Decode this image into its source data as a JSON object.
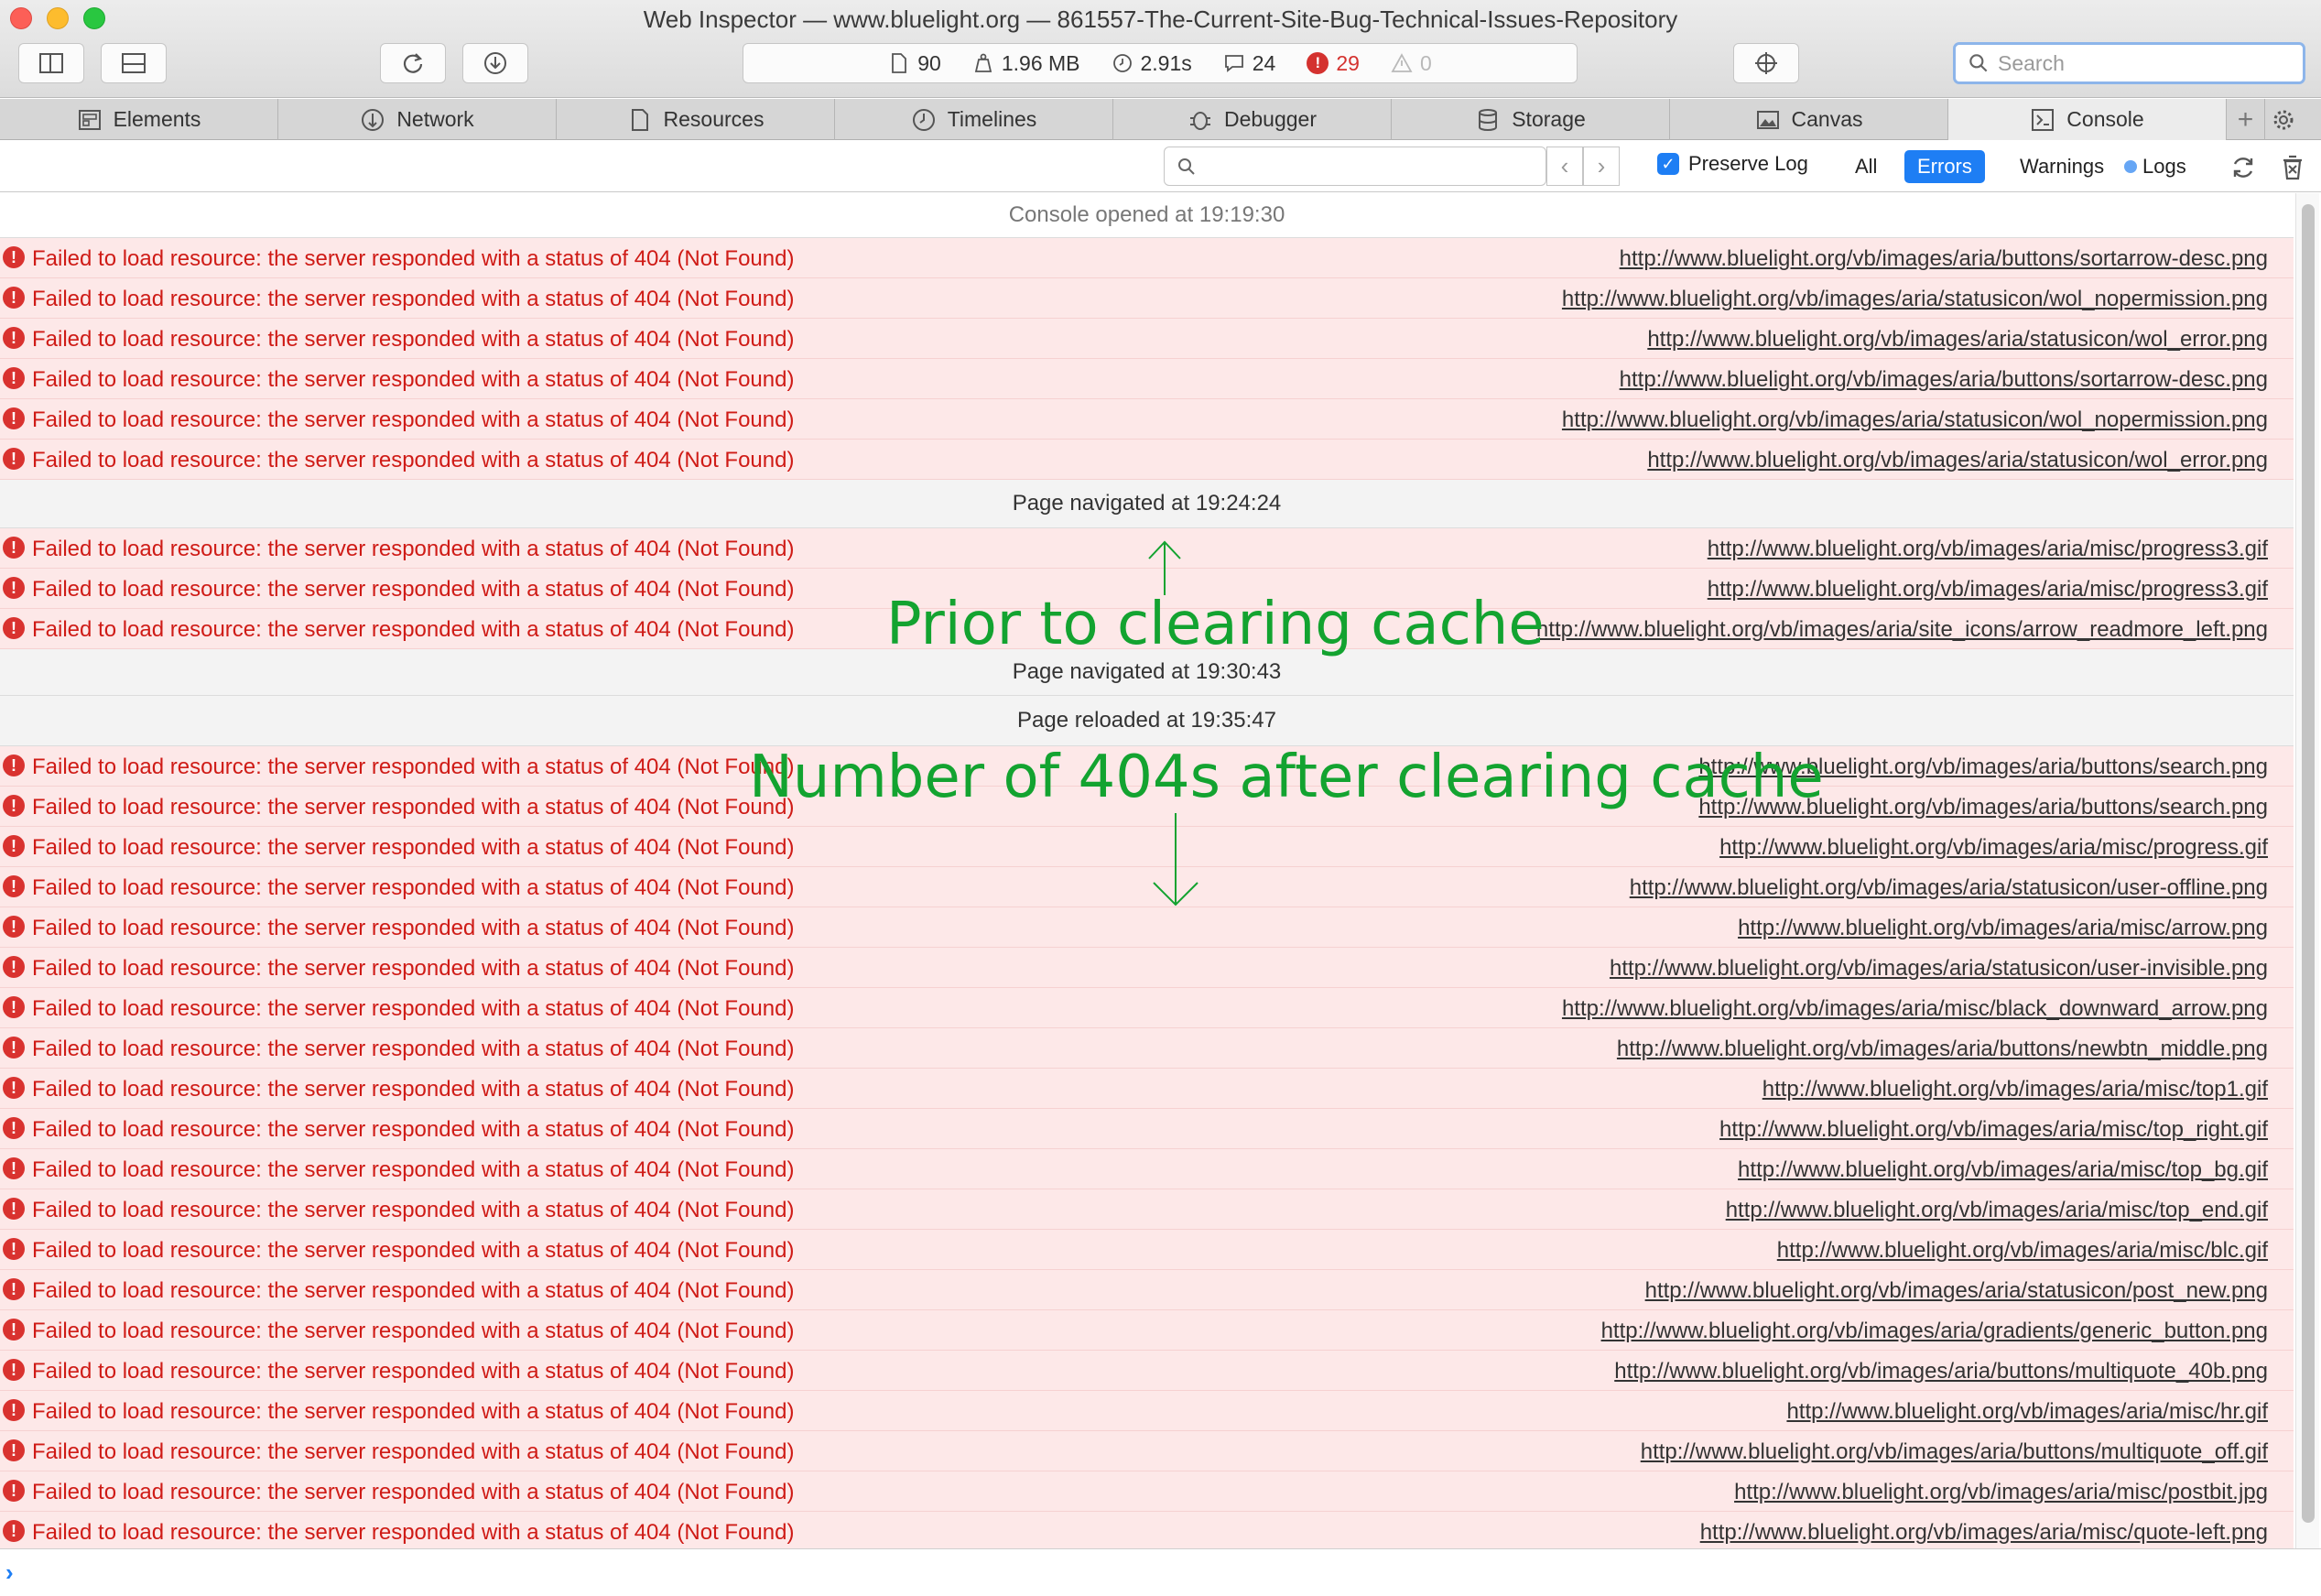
{
  "window": {
    "title": "Web Inspector — www.bluelight.org — 861557-The-Current-Site-Bug-Technical-Issues-Repository"
  },
  "dashboard": {
    "resources": "90",
    "size": "1.96 MB",
    "time": "2.91s",
    "logs": "24",
    "errors": "29",
    "warnings": "0"
  },
  "search": {
    "placeholder": "Search"
  },
  "tabs": [
    {
      "label": "Elements",
      "icon": "elements-icon"
    },
    {
      "label": "Network",
      "icon": "network-icon"
    },
    {
      "label": "Resources",
      "icon": "resources-icon"
    },
    {
      "label": "Timelines",
      "icon": "timelines-icon"
    },
    {
      "label": "Debugger",
      "icon": "debugger-icon"
    },
    {
      "label": "Storage",
      "icon": "storage-icon"
    },
    {
      "label": "Canvas",
      "icon": "canvas-icon"
    },
    {
      "label": "Console",
      "icon": "console-icon",
      "active": true
    }
  ],
  "filter": {
    "preserve_log": "Preserve Log",
    "all": "All",
    "errors": "Errors",
    "warnings": "Warnings",
    "logs": "Logs",
    "active_filter": "Errors"
  },
  "console": {
    "error_message": "Failed to load resource: the server responded with a status of 404 (Not Found)",
    "opened": "Console opened at 19:19:30",
    "group1": [
      "http://www.bluelight.org/vb/images/aria/buttons/sortarrow-desc.png",
      "http://www.bluelight.org/vb/images/aria/statusicon/wol_nopermission.png",
      "http://www.bluelight.org/vb/images/aria/statusicon/wol_error.png",
      "http://www.bluelight.org/vb/images/aria/buttons/sortarrow-desc.png",
      "http://www.bluelight.org/vb/images/aria/statusicon/wol_nopermission.png",
      "http://www.bluelight.org/vb/images/aria/statusicon/wol_error.png"
    ],
    "nav1": "Page navigated at 19:24:24",
    "group2": [
      "http://www.bluelight.org/vb/images/aria/misc/progress3.gif",
      "http://www.bluelight.org/vb/images/aria/misc/progress3.gif",
      "http://www.bluelight.org/vb/images/aria/site_icons/arrow_readmore_left.png"
    ],
    "nav2": "Page navigated at 19:30:43",
    "reload": "Page reloaded at 19:35:47",
    "group3": [
      "http://www.bluelight.org/vb/images/aria/buttons/search.png",
      "http://www.bluelight.org/vb/images/aria/buttons/search.png",
      "http://www.bluelight.org/vb/images/aria/misc/progress.gif",
      "http://www.bluelight.org/vb/images/aria/statusicon/user-offline.png",
      "http://www.bluelight.org/vb/images/aria/misc/arrow.png",
      "http://www.bluelight.org/vb/images/aria/statusicon/user-invisible.png",
      "http://www.bluelight.org/vb/images/aria/misc/black_downward_arrow.png",
      "http://www.bluelight.org/vb/images/aria/buttons/newbtn_middle.png",
      "http://www.bluelight.org/vb/images/aria/misc/top1.gif",
      "http://www.bluelight.org/vb/images/aria/misc/top_right.gif",
      "http://www.bluelight.org/vb/images/aria/misc/top_bg.gif",
      "http://www.bluelight.org/vb/images/aria/misc/top_end.gif",
      "http://www.bluelight.org/vb/images/aria/misc/blc.gif",
      "http://www.bluelight.org/vb/images/aria/statusicon/post_new.png",
      "http://www.bluelight.org/vb/images/aria/gradients/generic_button.png",
      "http://www.bluelight.org/vb/images/aria/buttons/multiquote_40b.png",
      "http://www.bluelight.org/vb/images/aria/misc/hr.gif",
      "http://www.bluelight.org/vb/images/aria/buttons/multiquote_off.gif",
      "http://www.bluelight.org/vb/images/aria/misc/postbit.jpg",
      "http://www.bluelight.org/vb/images/aria/misc/quote-left.png"
    ]
  },
  "annotations": {
    "before": "Prior to clearing cache",
    "after": "Number of 404s after clearing cache"
  },
  "colors": {
    "error_text": "#cf1b16",
    "error_row_bg": "#fde8e8",
    "accent_blue": "#1e7ef4",
    "annotation_green": "#13a330"
  }
}
